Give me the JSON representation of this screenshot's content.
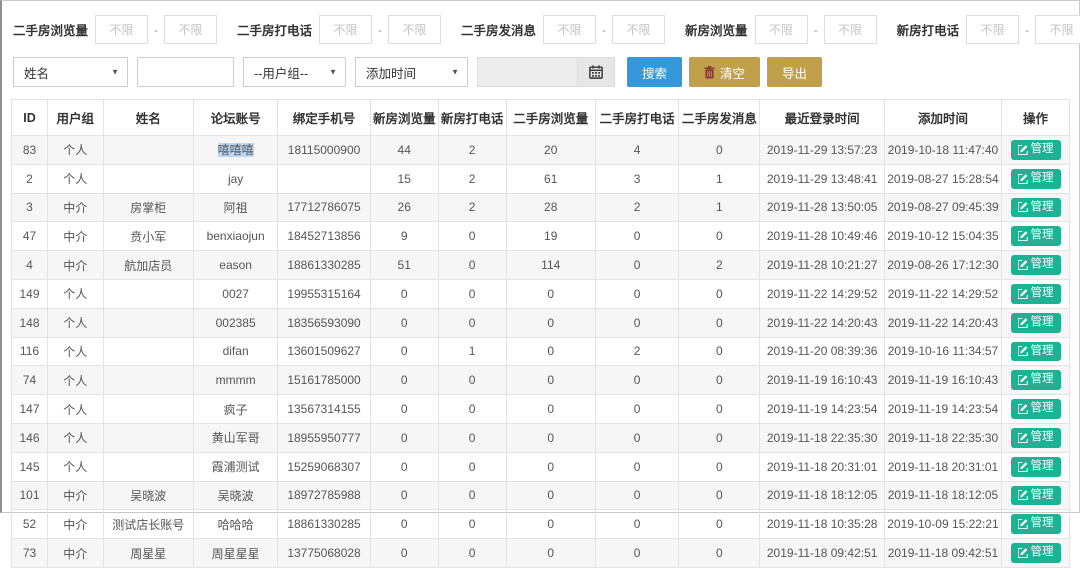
{
  "range_separator": "-",
  "filters_row1": [
    {
      "label": "二手房浏览量",
      "from_placeholder": "不限",
      "to_placeholder": "不限"
    },
    {
      "label": "二手房打电话",
      "from_placeholder": "不限",
      "to_placeholder": "不限"
    },
    {
      "label": "二手房发消息",
      "from_placeholder": "不限",
      "to_placeholder": "不限"
    },
    {
      "label": "新房浏览量",
      "from_placeholder": "不限",
      "to_placeholder": "不限"
    },
    {
      "label": "新房打电话",
      "from_placeholder": "不限",
      "to_placeholder": "不限"
    }
  ],
  "filters_row2": {
    "name_select_value": "姓名",
    "name_input_value": "",
    "usergroup_select_value": "--用户组--",
    "time_select_value": "添加时间",
    "date_input_value": "",
    "search_button": "搜索",
    "clear_button": "清空",
    "export_button": "导出"
  },
  "table": {
    "columns": [
      "ID",
      "用户组",
      "姓名",
      "论坛账号",
      "绑定手机号",
      "新房浏览量",
      "新房打电话",
      "二手房浏览量",
      "二手房打电话",
      "二手房发消息",
      "最近登录时间",
      "添加时间",
      "操作"
    ],
    "manage_button_label": "管理",
    "selected_cell": {
      "row": 0,
      "col": 3
    },
    "rows": [
      [
        "83",
        "个人",
        "",
        "嘻嘻嘻",
        "18115000900",
        "44",
        "2",
        "20",
        "4",
        "0",
        "2019-11-29 13:57:23",
        "2019-10-18 11:47:40"
      ],
      [
        "2",
        "个人",
        "",
        "jay",
        "",
        "15",
        "2",
        "61",
        "3",
        "1",
        "2019-11-29 13:48:41",
        "2019-08-27 15:28:54"
      ],
      [
        "3",
        "中介",
        "房掌柜",
        "阿祖",
        "17712786075",
        "26",
        "2",
        "28",
        "2",
        "1",
        "2019-11-28 13:50:05",
        "2019-08-27 09:45:39"
      ],
      [
        "47",
        "中介",
        "贲小军",
        "benxiaojun",
        "18452713856",
        "9",
        "0",
        "19",
        "0",
        "0",
        "2019-11-28 10:49:46",
        "2019-10-12 15:04:35"
      ],
      [
        "4",
        "中介",
        "航加店员",
        "eason",
        "18861330285",
        "51",
        "0",
        "114",
        "0",
        "2",
        "2019-11-28 10:21:27",
        "2019-08-26 17:12:30"
      ],
      [
        "149",
        "个人",
        "",
        "0027",
        "19955315164",
        "0",
        "0",
        "0",
        "0",
        "0",
        "2019-11-22 14:29:52",
        "2019-11-22 14:29:52"
      ],
      [
        "148",
        "个人",
        "",
        "002385",
        "18356593090",
        "0",
        "0",
        "0",
        "0",
        "0",
        "2019-11-22 14:20:43",
        "2019-11-22 14:20:43"
      ],
      [
        "116",
        "个人",
        "",
        "difan",
        "13601509627",
        "0",
        "1",
        "0",
        "2",
        "0",
        "2019-11-20 08:39:36",
        "2019-10-16 11:34:57"
      ],
      [
        "74",
        "个人",
        "",
        "mmmm",
        "15161785000",
        "0",
        "0",
        "0",
        "0",
        "0",
        "2019-11-19 16:10:43",
        "2019-11-19 16:10:43"
      ],
      [
        "147",
        "个人",
        "",
        "疯子",
        "13567314155",
        "0",
        "0",
        "0",
        "0",
        "0",
        "2019-11-19 14:23:54",
        "2019-11-19 14:23:54"
      ],
      [
        "146",
        "个人",
        "",
        "黄山军哥",
        "18955950777",
        "0",
        "0",
        "0",
        "0",
        "0",
        "2019-11-18 22:35:30",
        "2019-11-18 22:35:30"
      ],
      [
        "145",
        "个人",
        "",
        "霞浦测试",
        "15259068307",
        "0",
        "0",
        "0",
        "0",
        "0",
        "2019-11-18 20:31:01",
        "2019-11-18 20:31:01"
      ],
      [
        "101",
        "中介",
        "吴晓波",
        "吴晓波",
        "18972785988",
        "0",
        "0",
        "0",
        "0",
        "0",
        "2019-11-18 18:12:05",
        "2019-11-18 18:12:05"
      ],
      [
        "52",
        "中介",
        "测试店长账号",
        "哈哈哈",
        "18861330285",
        "0",
        "0",
        "0",
        "0",
        "0",
        "2019-11-18 10:35:28",
        "2019-10-09 15:22:21"
      ],
      [
        "73",
        "中介",
        "周星星",
        "周星星星",
        "13775068028",
        "0",
        "0",
        "0",
        "0",
        "0",
        "2019-11-18 09:42:51",
        "2019-11-18 09:42:51"
      ]
    ]
  },
  "colors": {
    "search_blue": "#3598db",
    "action_gold": "#c0a04a",
    "manage_teal": "#1ab394",
    "stripe_gray": "#f6f6f6",
    "selection_blue": "#bcd6f5"
  }
}
